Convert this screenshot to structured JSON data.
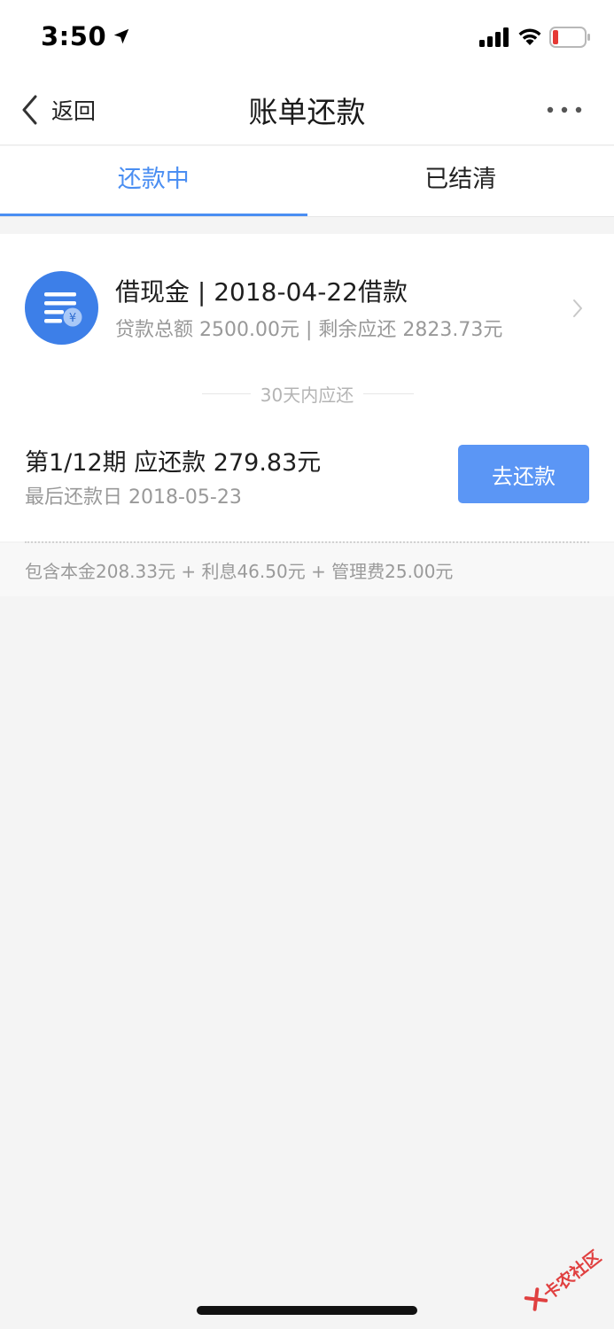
{
  "status_bar": {
    "time": "3:50",
    "icons": [
      "location-arrow-icon",
      "signal-icon",
      "wifi-icon",
      "battery-low-icon"
    ],
    "battery_color": "#e53935"
  },
  "nav": {
    "back_label": "返回",
    "title": "账单还款",
    "more_icon": "more-dots-icon"
  },
  "tabs": [
    {
      "label": "还款中",
      "active": true
    },
    {
      "label": "已结清",
      "active": false
    }
  ],
  "loan": {
    "title": "借现金 | 2018-04-22借款",
    "subtitle": "贷款总额 2500.00元 | 剩余应还 2823.73元",
    "icon": "loan-bill-icon",
    "icon_color": "#3d7fe8"
  },
  "section": {
    "label": "30天内应还"
  },
  "installment": {
    "title": "第1/12期 应还款 279.83元",
    "due_date": "最后还款日 2018-05-23",
    "button_label": "去还款",
    "button_color": "#5b96f5"
  },
  "breakdown": {
    "text": "包含本金208.33元 + 利息46.50元 + 管理费25.00元"
  },
  "watermark": {
    "text": "卡农社区"
  },
  "colors": {
    "accent": "#4a8ef2",
    "background": "#f4f4f4"
  }
}
